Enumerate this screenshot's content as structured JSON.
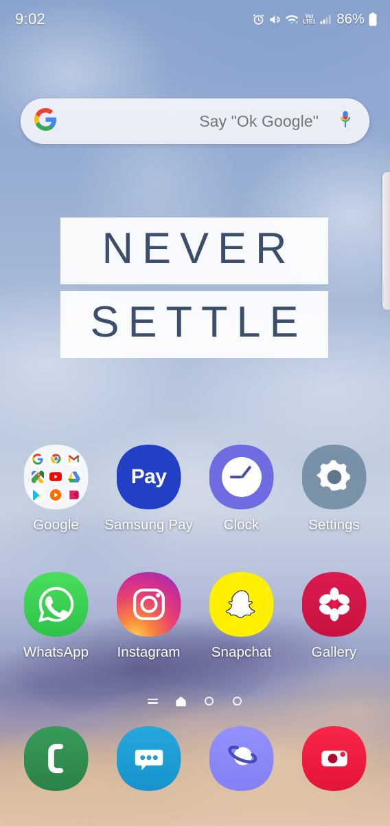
{
  "device": {
    "platform": "Samsung One UI home screen",
    "wallpaper_text_line1": "NEVER",
    "wallpaper_text_line2": "SETTLE"
  },
  "status_bar": {
    "clock": "9:02",
    "battery_percent": "86%",
    "network_label_top": "Vo)",
    "network_label_bottom": "LTE1",
    "icons": [
      {
        "name": "alarm-icon",
        "label": "Alarm set"
      },
      {
        "name": "mute-vibrate-icon",
        "label": "Sound muted"
      },
      {
        "name": "wifi-icon",
        "label": "Wi-Fi connected"
      },
      {
        "name": "volte-icon",
        "label": "VoLTE"
      },
      {
        "name": "signal-bars-icon",
        "label": "Mobile signal"
      },
      {
        "name": "battery-icon",
        "label": "Battery"
      }
    ]
  },
  "search_widget": {
    "placeholder": "Say \"Ok Google\"",
    "logo": "google-g-icon",
    "mic": "microphone-icon"
  },
  "apps": {
    "row1": [
      {
        "label": "Google",
        "icon": "google-folder-icon",
        "type": "folder",
        "folder_items": [
          "Google",
          "Chrome",
          "Gmail",
          "Maps",
          "YouTube",
          "Drive",
          "Play Store",
          "Play Music",
          "Play Movies"
        ]
      },
      {
        "label": "Samsung Pay",
        "icon": "samsung-pay-icon",
        "badge_text": "Pay",
        "color": "#2240c6"
      },
      {
        "label": "Clock",
        "icon": "clock-icon",
        "color": "#6e6ce0"
      },
      {
        "label": "Settings",
        "icon": "settings-gear-icon",
        "color": "#5d7a92"
      }
    ],
    "row2": [
      {
        "label": "WhatsApp",
        "icon": "whatsapp-icon",
        "color": "#35d14f"
      },
      {
        "label": "Instagram",
        "icon": "instagram-icon",
        "color": "#cf2e92"
      },
      {
        "label": "Snapchat",
        "icon": "snapchat-icon",
        "color": "#fff000"
      },
      {
        "label": "Gallery",
        "icon": "gallery-flower-icon",
        "color": "#d4164b"
      }
    ]
  },
  "page_indicator": {
    "pages": [
      {
        "type": "lines",
        "name": "page-feed",
        "active": false
      },
      {
        "type": "home",
        "name": "page-home",
        "active": true
      },
      {
        "type": "dot",
        "name": "page-3",
        "active": false
      },
      {
        "type": "dot",
        "name": "page-4",
        "active": false
      }
    ]
  },
  "dock": [
    {
      "label": "Phone",
      "icon": "phone-icon",
      "color": "#2f9150"
    },
    {
      "label": "Messages",
      "icon": "messages-icon",
      "color": "#1f9ed4"
    },
    {
      "label": "Internet",
      "icon": "browser-planet-icon",
      "color": "#8b88fa"
    },
    {
      "label": "Camera",
      "icon": "camera-icon",
      "color": "#f01c3f"
    }
  ],
  "edge_panel": {
    "name": "edge-panel-handle"
  }
}
